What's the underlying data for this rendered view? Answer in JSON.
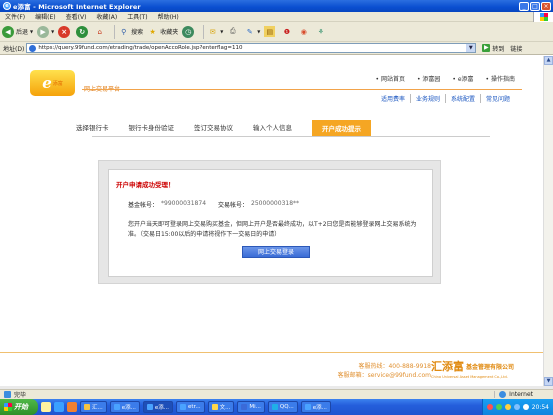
{
  "window": {
    "title": "e添富 - Microsoft Internet Explorer",
    "min": "_",
    "max": "□",
    "close": "×"
  },
  "menu": [
    "文件(F)",
    "编辑(E)",
    "查看(V)",
    "收藏(A)",
    "工具(T)",
    "帮助(H)"
  ],
  "toolbar": {
    "back": "后退",
    "search": "搜索",
    "favorites": "收藏夹"
  },
  "address": {
    "label": "地址(D)",
    "url": "https://query.99fund.com/etrading/trade/openAccoRole.jsp?enterflag=110",
    "go": "转到",
    "links": "链接"
  },
  "site": {
    "logo_mark": "e",
    "logo_text": "添富",
    "platform": "网上交易平台",
    "topnav": [
      "• 网站首页",
      "• 添富园",
      "• e添富",
      "• 操作指南"
    ],
    "subnav": [
      "适用费率",
      "业务规则",
      "系统配置",
      "常见问题"
    ],
    "steps": [
      "选择银行卡",
      "银行卡身份验证",
      "签订交易协议",
      "输入个人信息",
      "开户成功提示"
    ],
    "success_title": "开户申请成功受理！",
    "fund_account_label": "基金帐号：",
    "fund_account_value": "*99000031874",
    "trade_account_label": "交易帐号：",
    "trade_account_value": "25000000318**",
    "message": "您开户当天即可登录网上交易购买基金，但网上开户是否最终成功，以T+2日您是否能够登录网上交易系统为准。（交易日15:00以后的申请将视作下一交易日的申请）",
    "login_button": "网上交易登录",
    "hotline": "客服热线：400-888-9918",
    "email": "客服邮箱：service@99fund.com",
    "brand_cn": "汇添富",
    "brand_sub": "基金管理有限公司",
    "brand_en": "China Universal Asset Management Co.,Ltd."
  },
  "status": {
    "text": "完毕",
    "zone": "Internet"
  },
  "taskbar": {
    "start": "开始",
    "tasks": [
      "汇...",
      "e添...",
      "e添...",
      "etr...",
      "文...",
      "Mi...",
      "QQ...",
      "e添..."
    ],
    "time": "20:54"
  }
}
